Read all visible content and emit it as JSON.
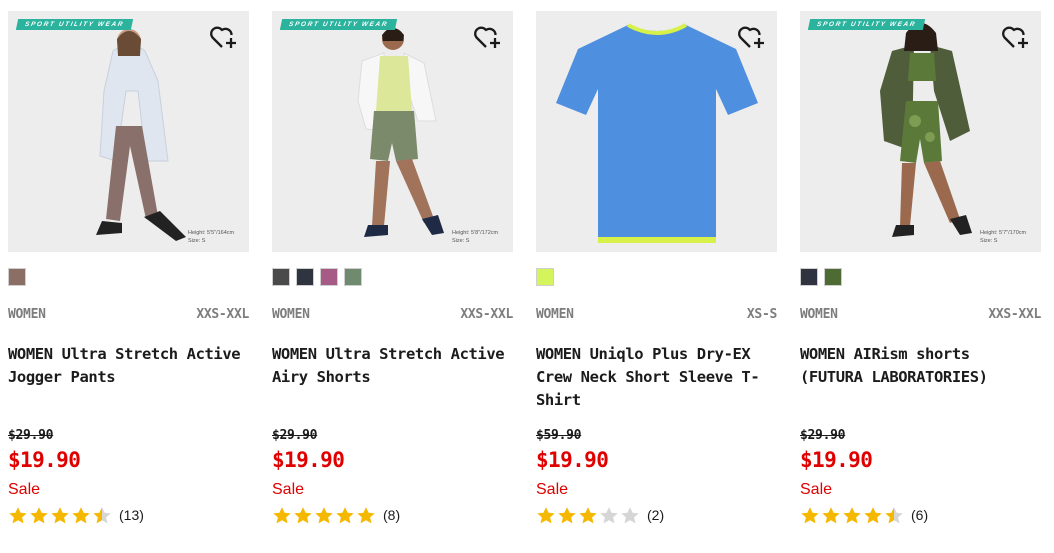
{
  "colors": {
    "sale_red": "#e00000",
    "star_gold": "#f5b800",
    "star_empty": "#d6d6d6",
    "badge_teal": "#2bb39d"
  },
  "products": [
    {
      "badge": "SPORT UTILITY WEAR",
      "model_height": "Height: 5'5\"/164cm",
      "model_size": "Size: S",
      "swatch_colors": [
        "#8b6e66"
      ],
      "gender": "WOMEN",
      "sizes": "XXS-XXL",
      "name": "WOMEN Ultra Stretch Active Jogger Pants",
      "original_price": "$29.90",
      "price": "$19.90",
      "sale_label": "Sale",
      "rating": 4.5,
      "review_count": "(13)"
    },
    {
      "badge": "SPORT UTILITY WEAR",
      "model_height": "Height: 5'8\"/172cm",
      "model_size": "Size: S",
      "swatch_colors": [
        "#4a4a4a",
        "#2f3440",
        "#a55b85",
        "#6f8a6e"
      ],
      "gender": "WOMEN",
      "sizes": "XXS-XXL",
      "name": "WOMEN Ultra Stretch Active Airy Shorts",
      "original_price": "$29.90",
      "price": "$19.90",
      "sale_label": "Sale",
      "rating": 5,
      "review_count": "(8)"
    },
    {
      "badge": "",
      "model_height": "",
      "model_size": "",
      "swatch_colors": [
        "#d3f45a"
      ],
      "gender": "WOMEN",
      "sizes": "XS-S",
      "name": "WOMEN Uniqlo Plus Dry-EX Crew Neck Short Sleeve T-Shirt",
      "original_price": "$59.90",
      "price": "$19.90",
      "sale_label": "Sale",
      "rating": 3,
      "review_count": "(2)"
    },
    {
      "badge": "SPORT UTILITY WEAR",
      "model_height": "Height: 5'7\"/170cm",
      "model_size": "Size: S",
      "swatch_colors": [
        "#2f3440",
        "#4f6b34"
      ],
      "gender": "WOMEN",
      "sizes": "XXS-XXL",
      "name": "WOMEN AIRism shorts (FUTURA LABORATORIES)",
      "original_price": "$29.90",
      "price": "$19.90",
      "sale_label": "Sale",
      "rating": 4.5,
      "review_count": "(6)"
    }
  ]
}
